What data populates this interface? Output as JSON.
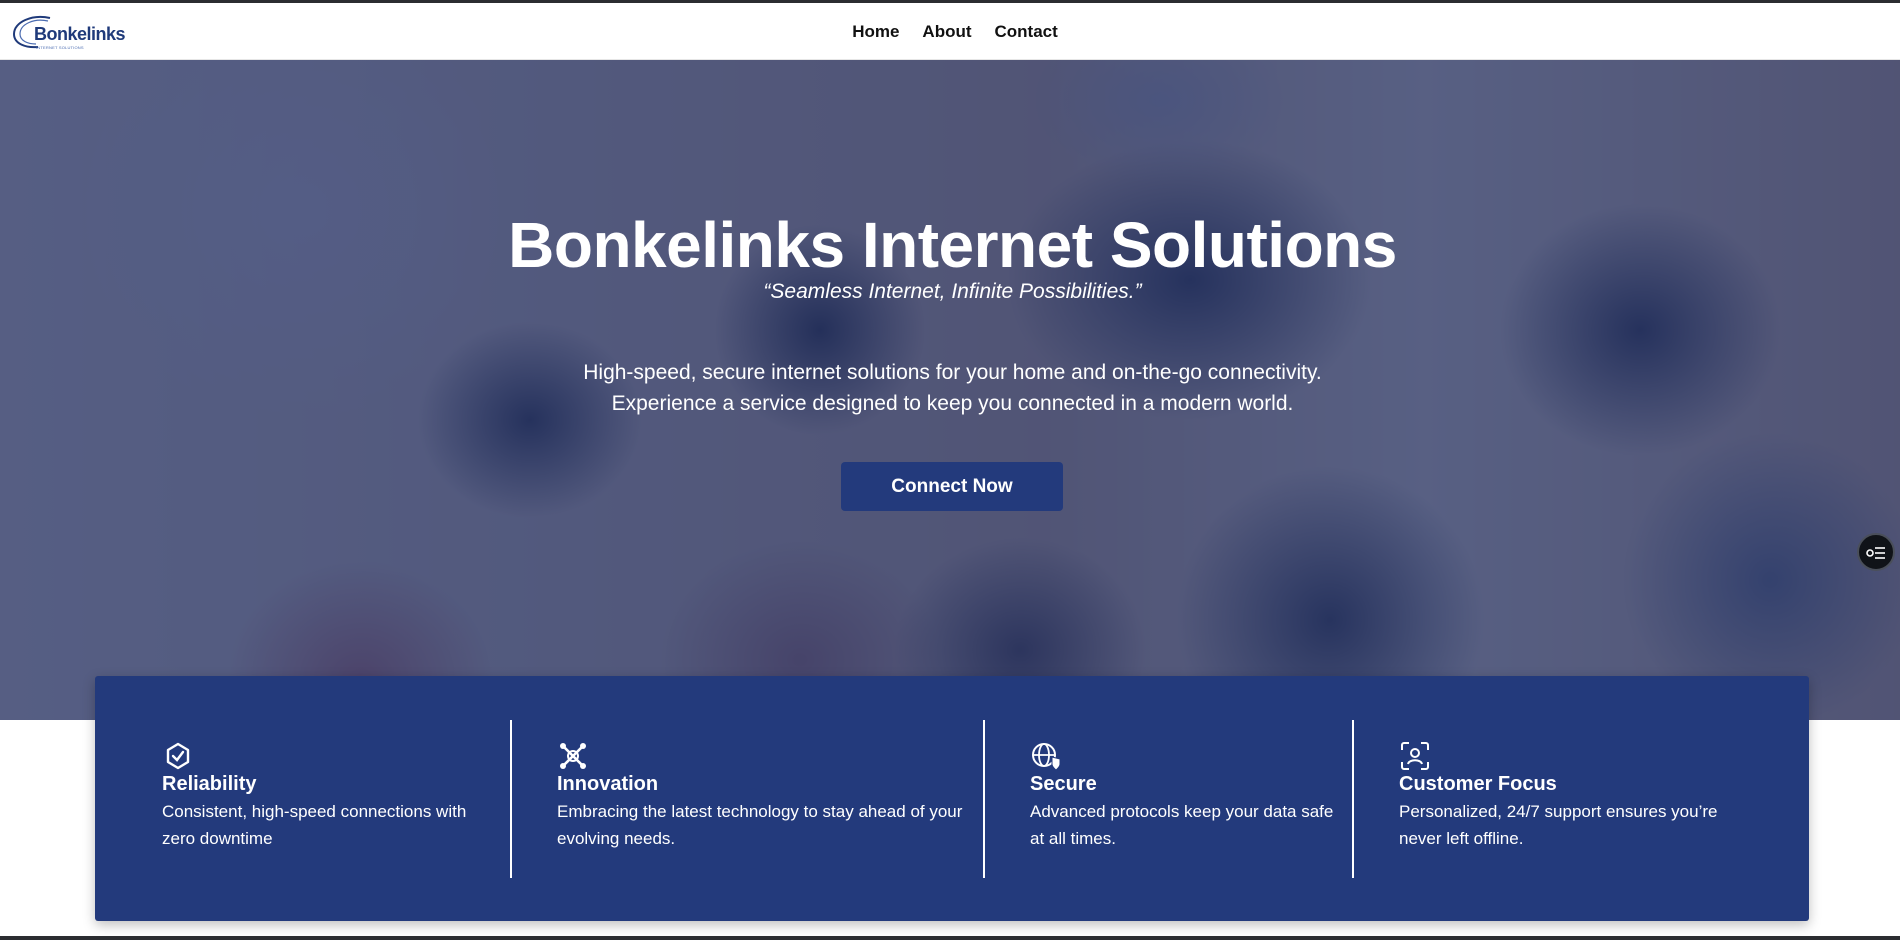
{
  "brand": {
    "name": "Bonkelinks",
    "tagline": "INTERNET SOLUTIONS",
    "accent_color": "#233a7c"
  },
  "nav": {
    "items": [
      {
        "label": "Home"
      },
      {
        "label": "About"
      },
      {
        "label": "Contact"
      }
    ]
  },
  "hero": {
    "title": "Bonkelinks Internet Solutions",
    "tagline": "“Seamless Internet, Infinite Possibilities.”",
    "description_line1": "High-speed, secure internet solutions for your home and on-the-go connectivity.",
    "description_line2": "Experience a service designed to keep you connected in a modern world.",
    "cta_label": "Connect Now"
  },
  "floating_button": {
    "icon": "settings-list-icon"
  },
  "features": [
    {
      "icon": "check-badge-icon",
      "title": "Reliability",
      "line1": "Consistent, high-speed connections with",
      "line2": "zero downtime"
    },
    {
      "icon": "network-nodes-icon",
      "title": "Innovation",
      "line1": "Embracing the latest technology to stay ahead of your",
      "line2": "evolving needs."
    },
    {
      "icon": "globe-shield-icon",
      "title": "Secure",
      "line1": "Advanced protocols keep your data safe",
      "line2": "at all times."
    },
    {
      "icon": "face-scan-icon",
      "title": "Customer Focus",
      "line1": "Personalized, 24/7 support ensures you’re",
      "line2": "never left offline."
    }
  ]
}
